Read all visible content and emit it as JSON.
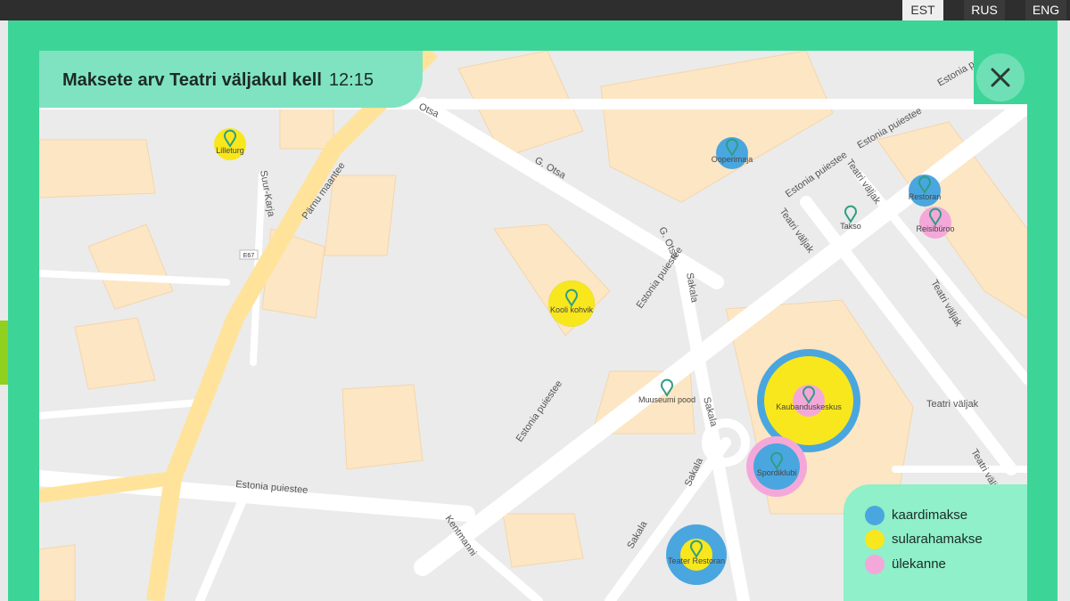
{
  "languages": [
    {
      "label": "EST",
      "active": true
    },
    {
      "label": "RUS",
      "active": false
    },
    {
      "label": "ENG",
      "active": false
    }
  ],
  "title": {
    "text": "Maksete arv Teatri väljakul kell",
    "time": "12:15"
  },
  "colors": {
    "kaardimakse": "#4aa6df",
    "sularahamakse": "#f8e71c",
    "ulekanne": "#f4a8d9",
    "frame": "#3cd597",
    "marker": "#2e9e83"
  },
  "legend": [
    {
      "label": "kaardimakse",
      "color": "#4aa6df"
    },
    {
      "label": "sularahamakse",
      "color": "#f8e71c"
    },
    {
      "label": "ülekanne",
      "color": "#f4a8d9"
    }
  ],
  "streets": [
    {
      "name": "Pärnu maantee"
    },
    {
      "name": "Otsa"
    },
    {
      "name": "G. Otsa"
    },
    {
      "name": "G. Otsa"
    },
    {
      "name": "Estonia puiestee"
    },
    {
      "name": "Estonia puiestee"
    },
    {
      "name": "Estonia puiestee"
    },
    {
      "name": "Estonia puiestee"
    },
    {
      "name": "Estonia puiestee"
    },
    {
      "name": "Estonia puiestee"
    },
    {
      "name": "Sakala"
    },
    {
      "name": "Sakala"
    },
    {
      "name": "Sakala"
    },
    {
      "name": "Sakala"
    },
    {
      "name": "Teatri väljak"
    },
    {
      "name": "Teatri väljak"
    },
    {
      "name": "Teatri väljak"
    },
    {
      "name": "Teatri väljak"
    },
    {
      "name": "Teatri väljak"
    },
    {
      "name": "Kentmanni"
    },
    {
      "name": "Suur-Karja"
    },
    {
      "name": "E67"
    }
  ],
  "places": [
    {
      "name": "Lilleturg",
      "kaardimakse": 0,
      "sularahamakse": 1,
      "ulekanne": 0
    },
    {
      "name": "Ooperimaja",
      "kaardimakse": 1,
      "sularahamakse": 0,
      "ulekanne": 0
    },
    {
      "name": "Kooli kohvik",
      "kaardimakse": 2,
      "sularahamakse": 2,
      "ulekanne": 0
    },
    {
      "name": "Restoran",
      "kaardimakse": 1,
      "sularahamakse": 0,
      "ulekanne": 0
    },
    {
      "name": "Reisibüroo",
      "kaardimakse": 0,
      "sularahamakse": 0,
      "ulekanne": 1
    },
    {
      "name": "Takso",
      "kaardimakse": 0,
      "sularahamakse": 0,
      "ulekanne": 0
    },
    {
      "name": "Muuseumi pood",
      "kaardimakse": 0,
      "sularahamakse": 0,
      "ulekanne": 0
    },
    {
      "name": "Kaubanduskeskus",
      "kaardimakse": 6,
      "sularahamakse": 5,
      "ulekanne": 1
    },
    {
      "name": "Spordiklubi",
      "kaardimakse": 2,
      "sularahamakse": 0,
      "ulekanne": 3
    },
    {
      "name": "Teater Restoran",
      "kaardimakse": 3,
      "sularahamakse": 1,
      "ulekanne": 0
    }
  ]
}
